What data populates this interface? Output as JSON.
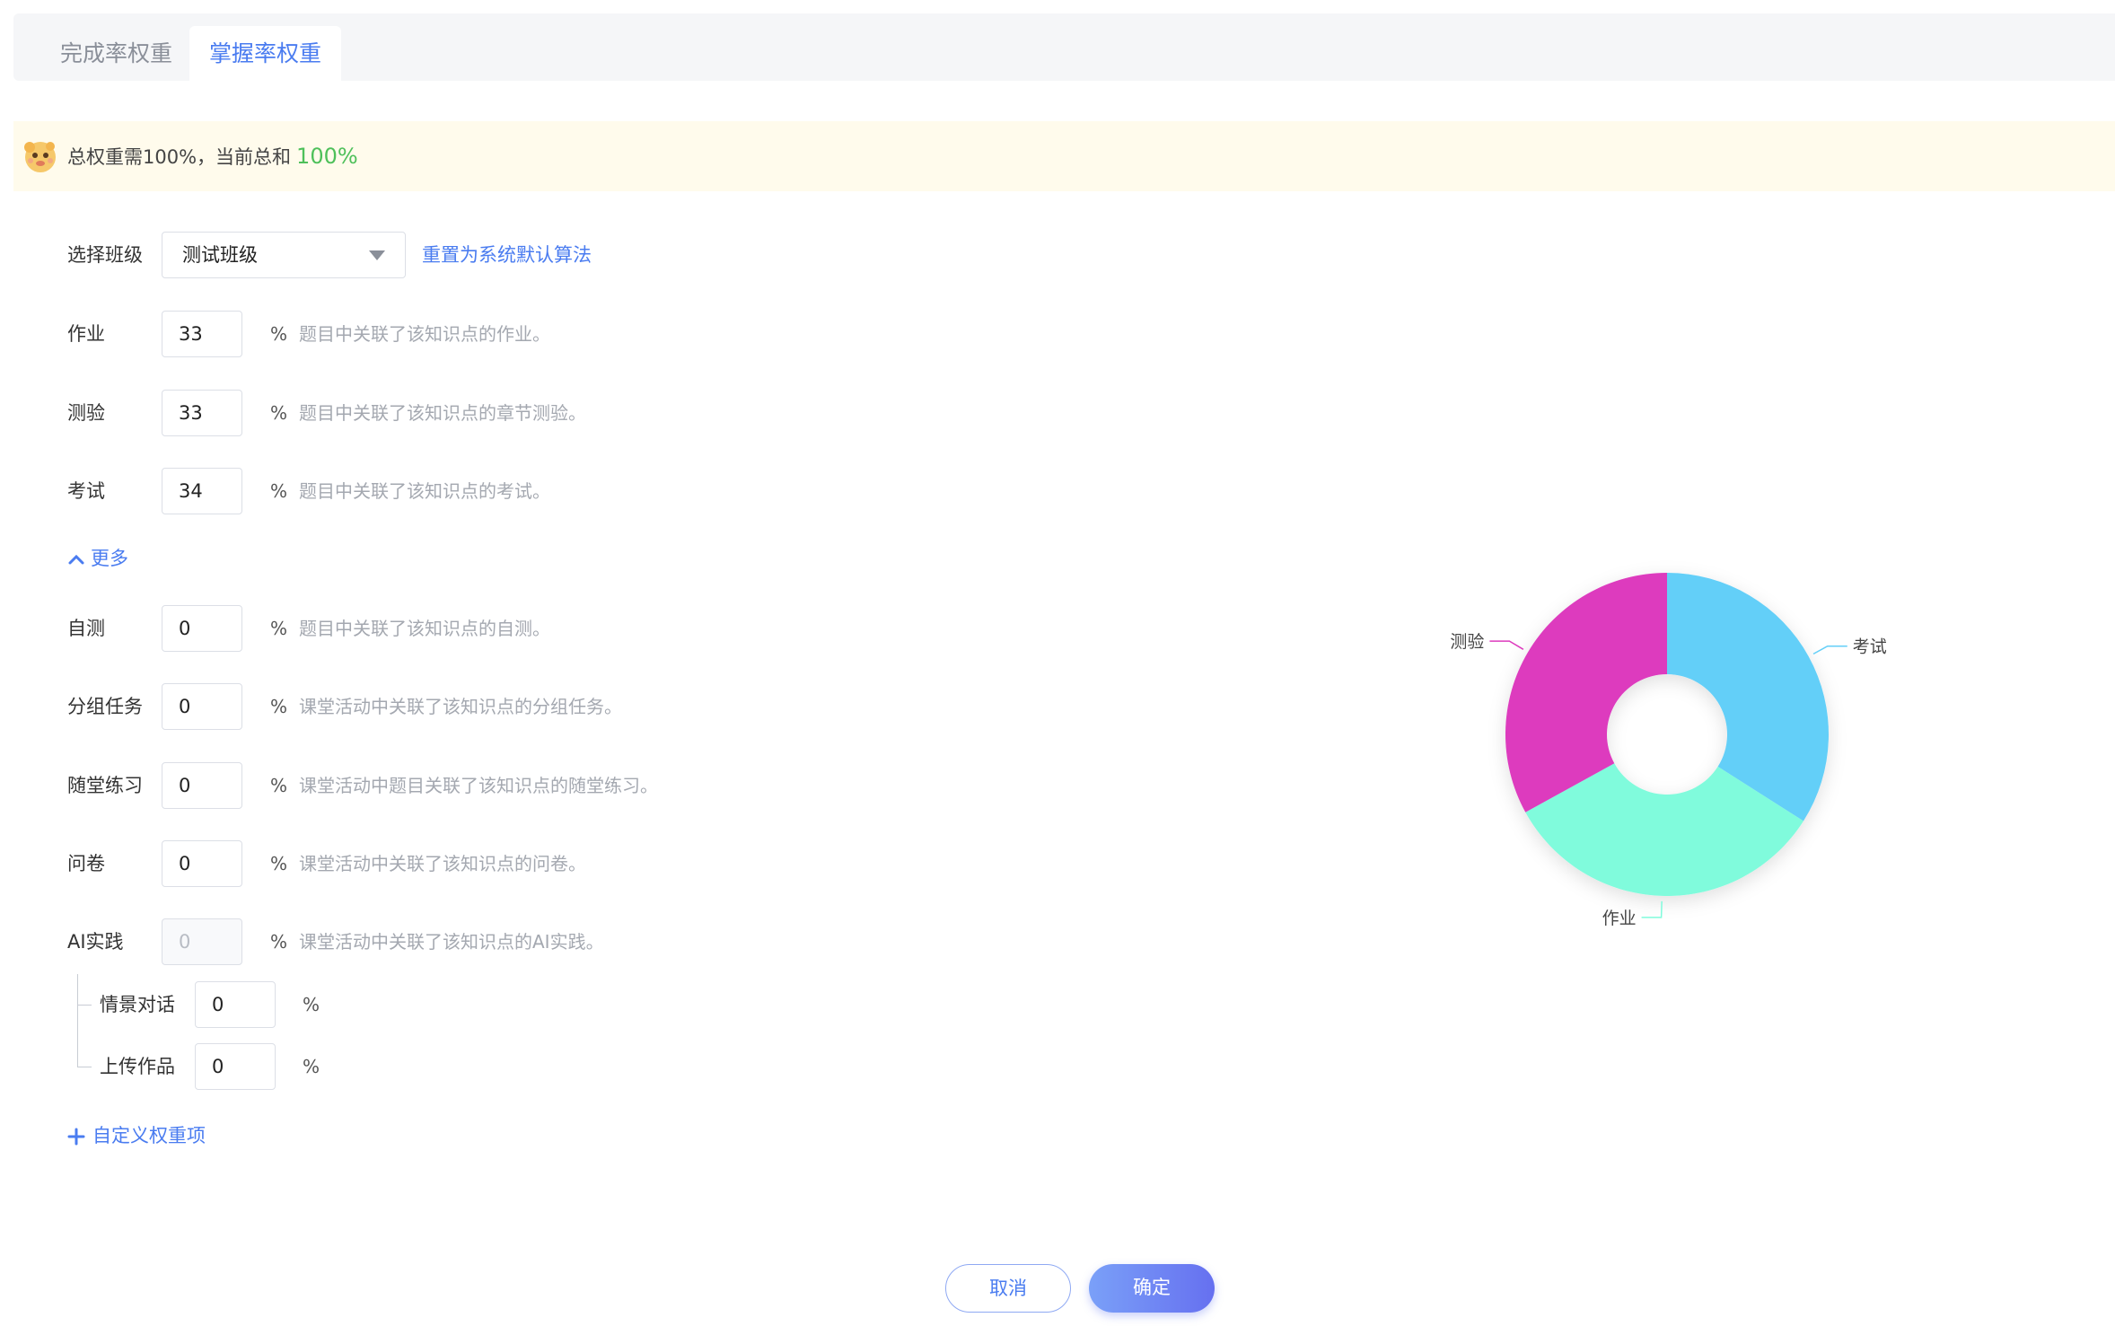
{
  "tabs": [
    {
      "label": "完成率权重"
    },
    {
      "label": "掌握率权重"
    }
  ],
  "notice": {
    "text": "总权重需100%，当前总和",
    "total": "100%"
  },
  "class_select": {
    "label": "选择班级",
    "value": "测试班级",
    "reset_link": "重置为系统默认算法"
  },
  "weights": [
    {
      "label": "作业",
      "value": "33",
      "unit": "%",
      "desc": "题目中关联了该知识点的作业。"
    },
    {
      "label": "测验",
      "value": "33",
      "unit": "%",
      "desc": "题目中关联了该知识点的章节测验。"
    },
    {
      "label": "考试",
      "value": "34",
      "unit": "%",
      "desc": "题目中关联了该知识点的考试。"
    }
  ],
  "more_toggle": "更多",
  "more_weights": [
    {
      "label": "自测",
      "value": "0",
      "unit": "%",
      "desc": "题目中关联了该知识点的自测。"
    },
    {
      "label": "分组任务",
      "value": "0",
      "unit": "%",
      "desc": "课堂活动中关联了该知识点的分组任务。"
    },
    {
      "label": "随堂练习",
      "value": "0",
      "unit": "%",
      "desc": "课堂活动中题目关联了该知识点的随堂练习。"
    },
    {
      "label": "问卷",
      "value": "0",
      "unit": "%",
      "desc": "课堂活动中关联了该知识点的问卷。"
    },
    {
      "label": "AI实践",
      "value": "0",
      "unit": "%",
      "desc": "课堂活动中关联了该知识点的AI实践。"
    }
  ],
  "ai_sub": [
    {
      "label": "情景对话",
      "value": "0",
      "unit": "%"
    },
    {
      "label": "上传作品",
      "value": "0",
      "unit": "%"
    }
  ],
  "custom_add": "自定义权重项",
  "buttons": {
    "cancel": "取消",
    "ok": "确定"
  },
  "colors": {
    "accent": "#4a7cf0",
    "success": "#4ec05a",
    "notice_bg": "#fffbec"
  },
  "chart_data": {
    "type": "pie",
    "categories": [
      "考试",
      "作业",
      "测验"
    ],
    "values": [
      34,
      33,
      33
    ],
    "colors": [
      "#64cff8",
      "#80fbdc",
      "#dd3bbe"
    ],
    "title": "",
    "donut": true
  }
}
